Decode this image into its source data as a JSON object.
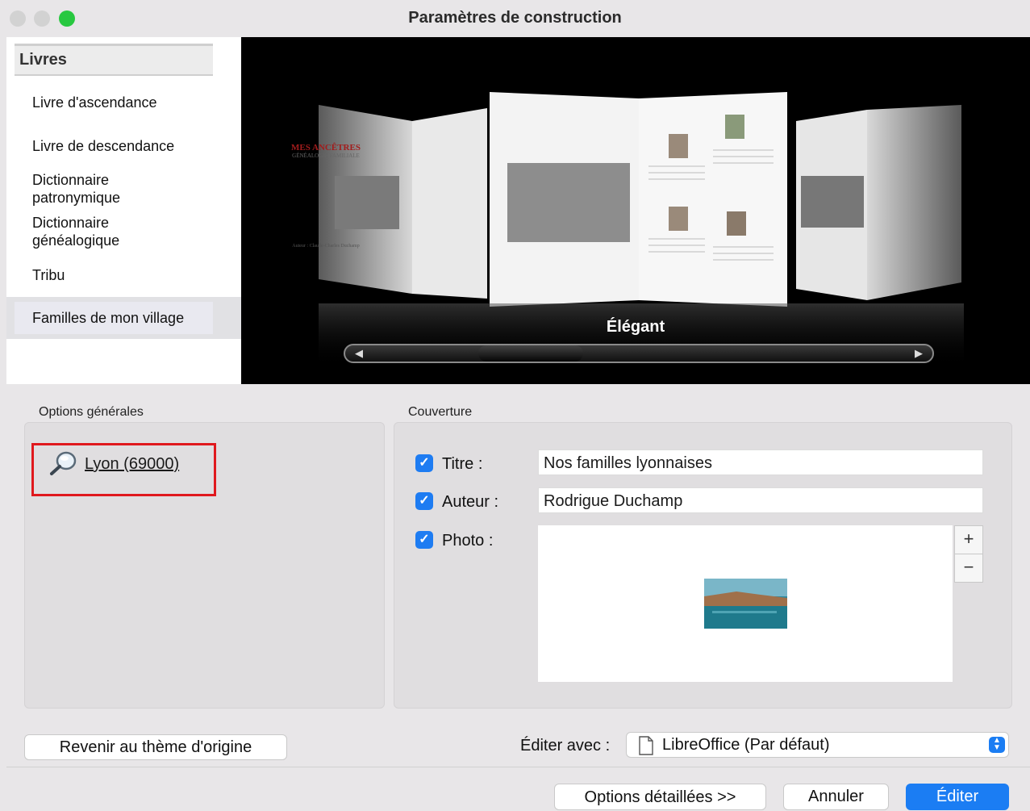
{
  "window": {
    "title": "Paramètres de construction"
  },
  "sidebar": {
    "header": "Livres",
    "items": [
      {
        "label": "Livre d'ascendance"
      },
      {
        "label": "Livre de descendance"
      },
      {
        "label": "Dictionnaire\npatronymique"
      },
      {
        "label": "Dictionnaire\ngénéalogique"
      },
      {
        "label": "Tribu"
      },
      {
        "label": "Familles de mon village",
        "selected": true
      }
    ]
  },
  "preview": {
    "style_name": "Élégant",
    "book_title": "MES ANCÊTRES",
    "book_subtitle": "GÉNÉALOGIE FAMILIALE",
    "book_author": "Auteur : Claude-Charles Duchamp"
  },
  "general_options": {
    "label": "Options générales",
    "location_link": "Lyon (69000)"
  },
  "cover": {
    "label": "Couverture",
    "title_label": "Titre :",
    "title_value": "Nos familles lyonnaises",
    "title_checked": true,
    "author_label": "Auteur :",
    "author_value": "Rodrigue Duchamp",
    "author_checked": true,
    "photo_label": "Photo :",
    "photo_checked": true,
    "add_symbol": "+",
    "remove_symbol": "−"
  },
  "footer": {
    "reset_button": "Revenir au thème d'origine",
    "edit_with_label": "Éditer avec :",
    "edit_with_value": "LibreOffice (Par défaut)",
    "details_button": "Options détaillées >>",
    "cancel_button": "Annuler",
    "edit_button": "Éditer"
  },
  "colors": {
    "accent": "#1b7df3",
    "highlight_box": "#e0191e",
    "close": "#d0d0d0",
    "zoom": "#27c93f"
  }
}
